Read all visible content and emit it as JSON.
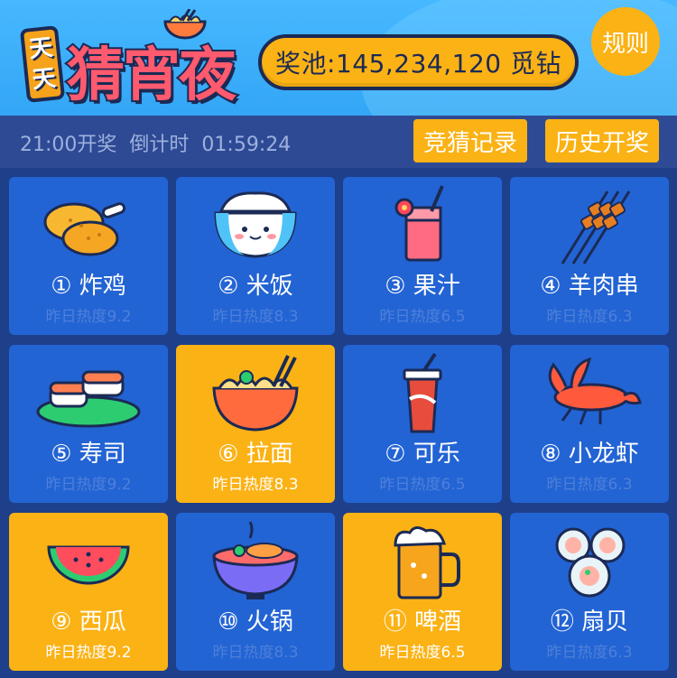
{
  "header": {
    "logo_small": [
      "天",
      "天"
    ],
    "logo_title": "猜宵夜",
    "pool_label": "奖池:145,234,120 觅钻",
    "rules_label": "规则"
  },
  "infobar": {
    "draw_time": "21:00开奖",
    "countdown_label": "倒计时",
    "countdown_value": "01:59:24",
    "records_label": "竞猜记录",
    "history_label": "历史开奖"
  },
  "foods": [
    {
      "label": "① 炸鸡",
      "heat": "昨日热度9.2",
      "icon": "fried-chicken-icon",
      "selected": false
    },
    {
      "label": "② 米饭",
      "heat": "昨日热度8.3",
      "icon": "rice-bowl-icon",
      "selected": false
    },
    {
      "label": "③ 果汁",
      "heat": "昨日热度6.5",
      "icon": "juice-icon",
      "selected": false
    },
    {
      "label": "④ 羊肉串",
      "heat": "昨日热度6.3",
      "icon": "skewers-icon",
      "selected": false
    },
    {
      "label": "⑤ 寿司",
      "heat": "昨日热度9.2",
      "icon": "sushi-icon",
      "selected": false
    },
    {
      "label": "⑥ 拉面",
      "heat": "昨日热度8.3",
      "icon": "noodles-icon",
      "selected": true
    },
    {
      "label": "⑦ 可乐",
      "heat": "昨日热度6.5",
      "icon": "cola-icon",
      "selected": false
    },
    {
      "label": "⑧ 小龙虾",
      "heat": "昨日热度6.3",
      "icon": "crayfish-icon",
      "selected": false
    },
    {
      "label": "⑨ 西瓜",
      "heat": "昨日热度9.2",
      "icon": "watermelon-icon",
      "selected": true
    },
    {
      "label": "⑩ 火锅",
      "heat": "昨日热度8.3",
      "icon": "hotpot-icon",
      "selected": false
    },
    {
      "label": "⑪ 啤酒",
      "heat": "昨日热度6.5",
      "icon": "beer-icon",
      "selected": true
    },
    {
      "label": "⑫ 扇贝",
      "heat": "昨日热度6.3",
      "icon": "scallop-icon",
      "selected": false
    }
  ],
  "colors": {
    "accent": "#fbb214",
    "card": "#2364d4",
    "background": "#1e3f8a",
    "header": "#47b8ff"
  }
}
